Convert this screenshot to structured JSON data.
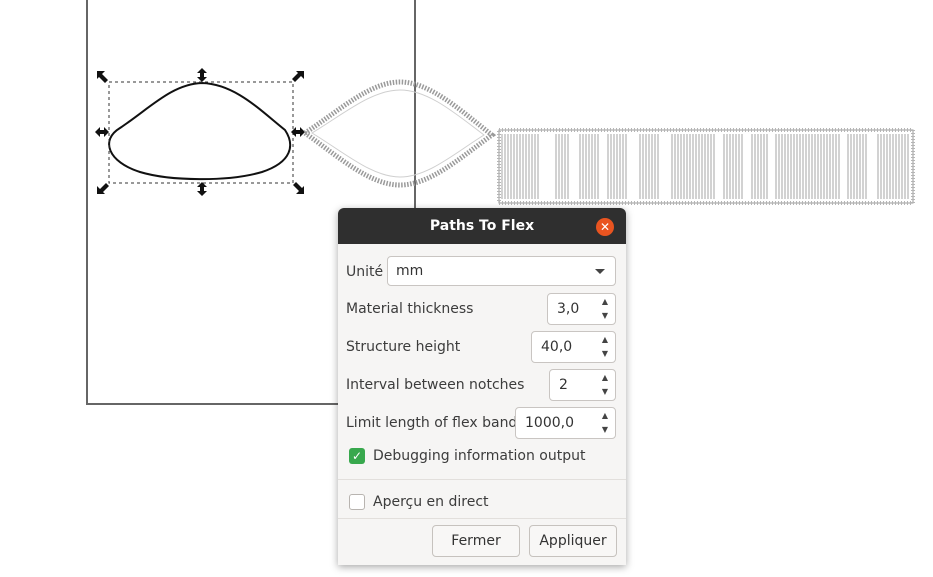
{
  "dialog": {
    "title": "Paths To Flex",
    "close_icon": "close-icon",
    "unit": {
      "label": "Unité",
      "value": "mm"
    },
    "fields": [
      {
        "label": "Material thickness",
        "value": "3,0"
      },
      {
        "label": "Structure height",
        "value": "40,0"
      },
      {
        "label": "Interval between notches",
        "value": "2"
      },
      {
        "label": "Limit length of flex band",
        "value": "1000,0"
      }
    ],
    "debug": {
      "label": "Debugging information output",
      "checked": true
    },
    "preview": {
      "label": "Aperçu en direct",
      "checked": false
    },
    "buttons": {
      "close": "Fermer",
      "apply": "Appliquer"
    }
  },
  "colors": {
    "titlebar": "#2f2f2f",
    "close": "#e95420",
    "check": "#38a84d"
  }
}
